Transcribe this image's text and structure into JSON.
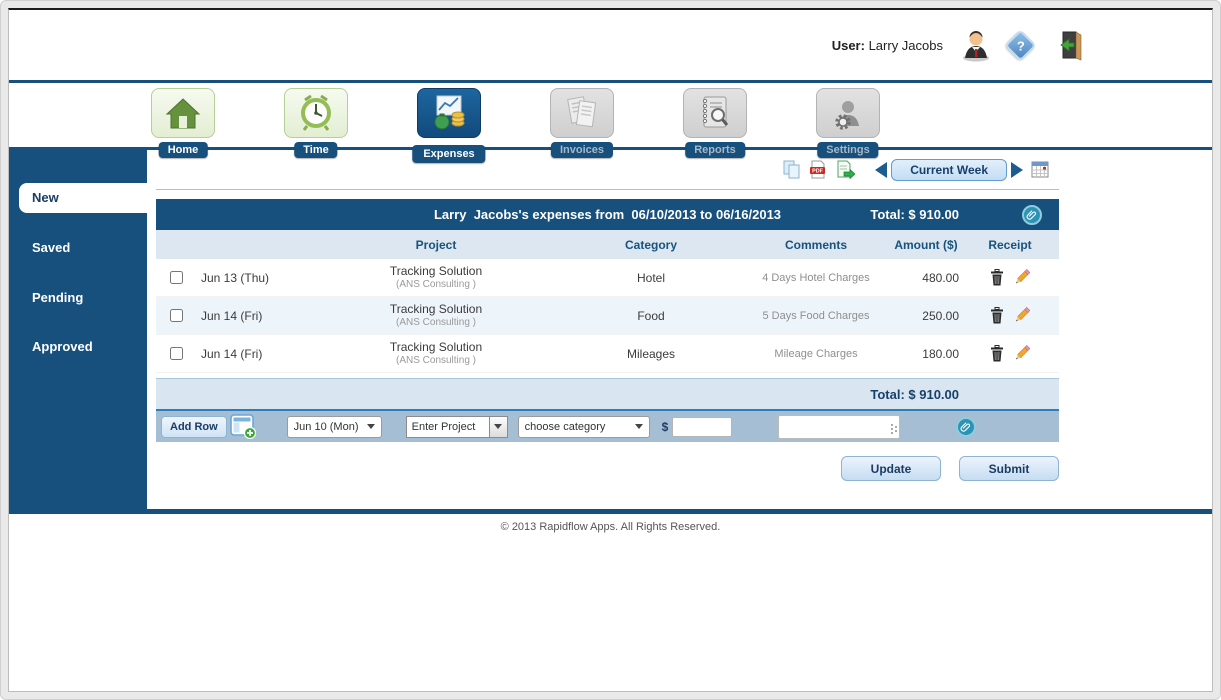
{
  "topbar": {
    "user_label": "User:",
    "user_name": "Larry Jacobs"
  },
  "nav": {
    "tabs": [
      {
        "label": "Home"
      },
      {
        "label": "Time"
      },
      {
        "label": "Expenses"
      },
      {
        "label": "Invoices"
      },
      {
        "label": "Reports"
      },
      {
        "label": "Settings"
      }
    ]
  },
  "sidebar": {
    "items": [
      {
        "label": "New"
      },
      {
        "label": "Saved"
      },
      {
        "label": "Pending"
      },
      {
        "label": "Approved"
      }
    ]
  },
  "toolbar": {
    "week_button": "Current Week"
  },
  "summary": {
    "title": "Larry  Jacobs's expenses from  06/10/2013 to 06/16/2013",
    "total": "Total: $ 910.00"
  },
  "table": {
    "headers": {
      "project": "Project",
      "category": "Category",
      "comments": "Comments",
      "amount": "Amount ($)",
      "receipt": "Receipt"
    },
    "rows": [
      {
        "date": "Jun 13 (Thu)",
        "project": "Tracking Solution",
        "project_sub": "(ANS Consulting )",
        "category": "Hotel",
        "comments": "4 Days Hotel Charges",
        "amount": "480.00"
      },
      {
        "date": "Jun 14 (Fri)",
        "project": "Tracking Solution",
        "project_sub": "(ANS Consulting )",
        "category": "Food",
        "comments": "5 Days Food Charges",
        "amount": "250.00"
      },
      {
        "date": "Jun 14 (Fri)",
        "project": "Tracking Solution",
        "project_sub": "(ANS Consulting )",
        "category": "Mileages",
        "comments": "Mileage Charges",
        "amount": "180.00"
      }
    ],
    "total": "Total: $ 910.00"
  },
  "add_row": {
    "button_label": "Add Row",
    "date_value": "Jun 10 (Mon)",
    "project_value": "Enter Project",
    "category_value": "choose category",
    "currency_symbol": "$"
  },
  "actions": {
    "update": "Update",
    "submit": "Submit"
  },
  "footer": {
    "copyright": "© 2013 Rapidflow Apps. All Rights Reserved."
  },
  "colors": {
    "brand_blue": "#17507d",
    "attachment_teal": "#2d93b4",
    "add_bar": "#a6bed4",
    "total_row": "#d9e5f1"
  }
}
